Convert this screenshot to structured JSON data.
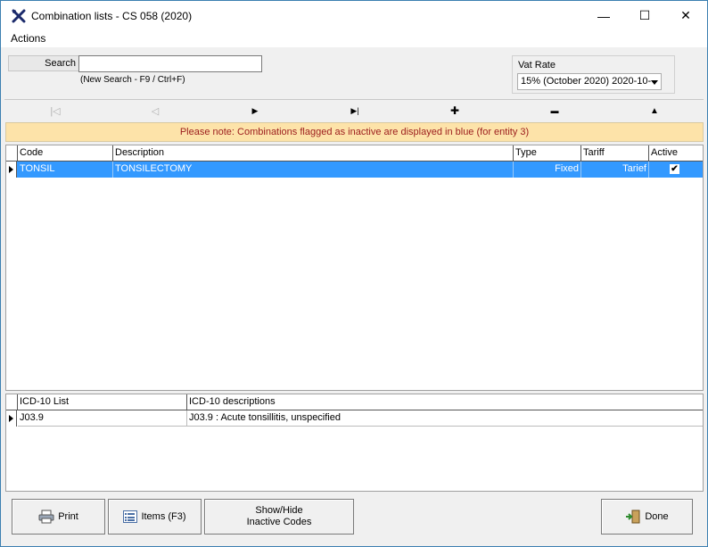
{
  "window": {
    "title": "Combination lists - CS 058 (2020)",
    "minimize_glyph": "—",
    "maximize_glyph": "☐",
    "close_glyph": "✕"
  },
  "menu": {
    "actions": "Actions"
  },
  "search": {
    "label": "Search",
    "value": "",
    "hint": "(New Search - F9 / Ctrl+F)"
  },
  "vat": {
    "label": "Vat Rate",
    "selected": "15% (October 2020) 2020-10-"
  },
  "nav": {
    "first": "|◁",
    "prev": "◁",
    "next": "▶",
    "last": "▶|",
    "add": "✚",
    "remove": "▬",
    "up": "▲"
  },
  "note": "Please note: Combinations flagged as inactive are displayed in blue (for entity 3)",
  "grid": {
    "columns": [
      "Code",
      "Description",
      "Type",
      "Tariff",
      "Active"
    ],
    "rows": [
      {
        "code": "TONSIL",
        "description": "TONSILECTOMY",
        "type": "Fixed",
        "tariff": "Tarief",
        "active": "✔"
      }
    ]
  },
  "icd": {
    "columns": [
      "ICD-10 List",
      "ICD-10 descriptions"
    ],
    "rows": [
      {
        "code": "J03.9",
        "description": "J03.9 : Acute tonsillitis, unspecified"
      }
    ]
  },
  "buttons": {
    "print": "Print",
    "items": "Items (F3)",
    "show_hide_line1": "Show/Hide",
    "show_hide_line2": "Inactive Codes",
    "done": "Done"
  },
  "colors": {
    "selection": "#3399ff",
    "note_bg": "#fde3a9",
    "note_text": "#9b1c1c"
  }
}
